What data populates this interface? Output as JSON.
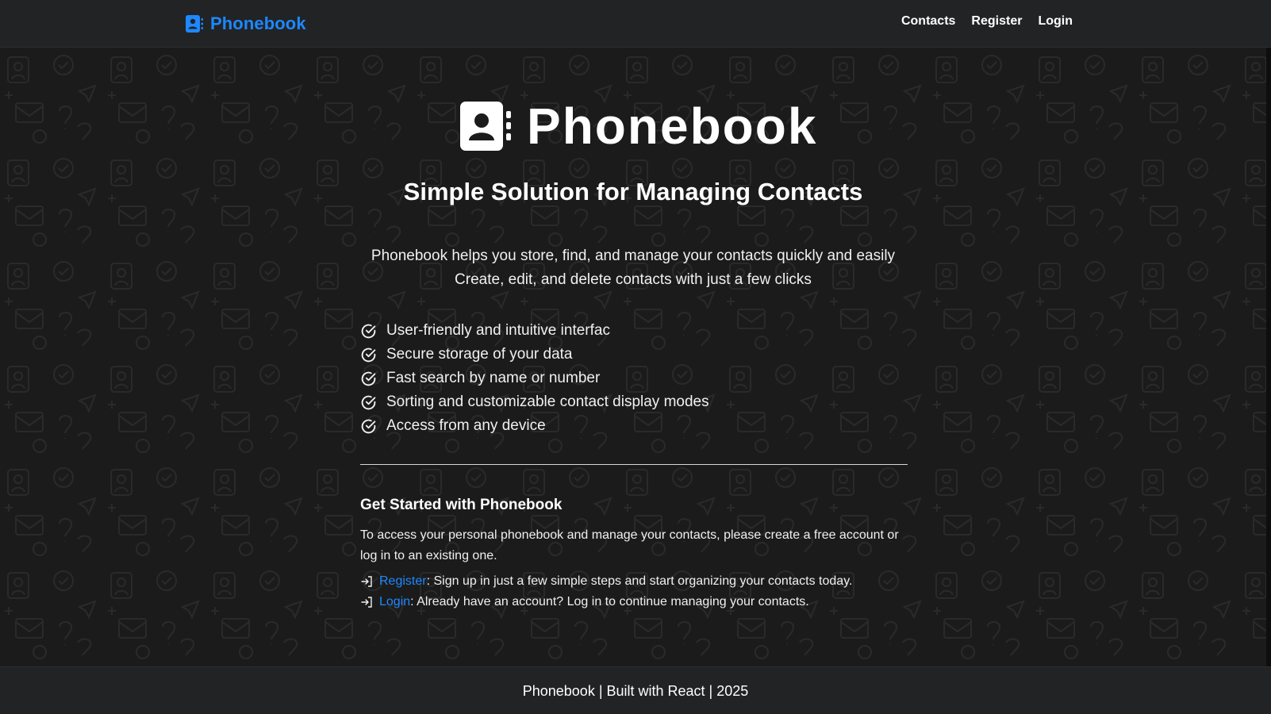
{
  "header": {
    "brand": "Phonebook",
    "nav": [
      "Contacts",
      "Register",
      "Login"
    ]
  },
  "hero": {
    "title": "Phonebook",
    "tagline": "Simple Solution for Managing Contacts",
    "description": [
      "Phonebook helps you store, find, and manage your contacts quickly and easily",
      "Create, edit, and delete contacts with just a few clicks"
    ],
    "features": [
      "User-friendly and intuitive interfac",
      "Secure storage of your data",
      "Fast search by name or number",
      "Sorting and customizable contact display modes",
      "Access from any device"
    ]
  },
  "get_started": {
    "title": "Get Started with Phonebook",
    "text": "To access your personal phonebook and manage your contacts, please create a free account or log in to an existing one.",
    "links": [
      {
        "label": "Register",
        "text": ": Sign up in just a few simple steps and start organizing your contacts today."
      },
      {
        "label": "Login",
        "text": ": Already have an account? Log in to continue managing your contacts."
      }
    ]
  },
  "footer": {
    "text": "Phonebook | Built with React | 2025"
  },
  "icons": {
    "brand": "contact-book-icon",
    "feature": "check-circle-icon",
    "link": "sign-in-arrow-icon"
  },
  "colors": {
    "accent": "#1e88ff",
    "header_bg": "#212325",
    "page_bg": "#1b1b1b",
    "text": "#f0f0f0"
  }
}
